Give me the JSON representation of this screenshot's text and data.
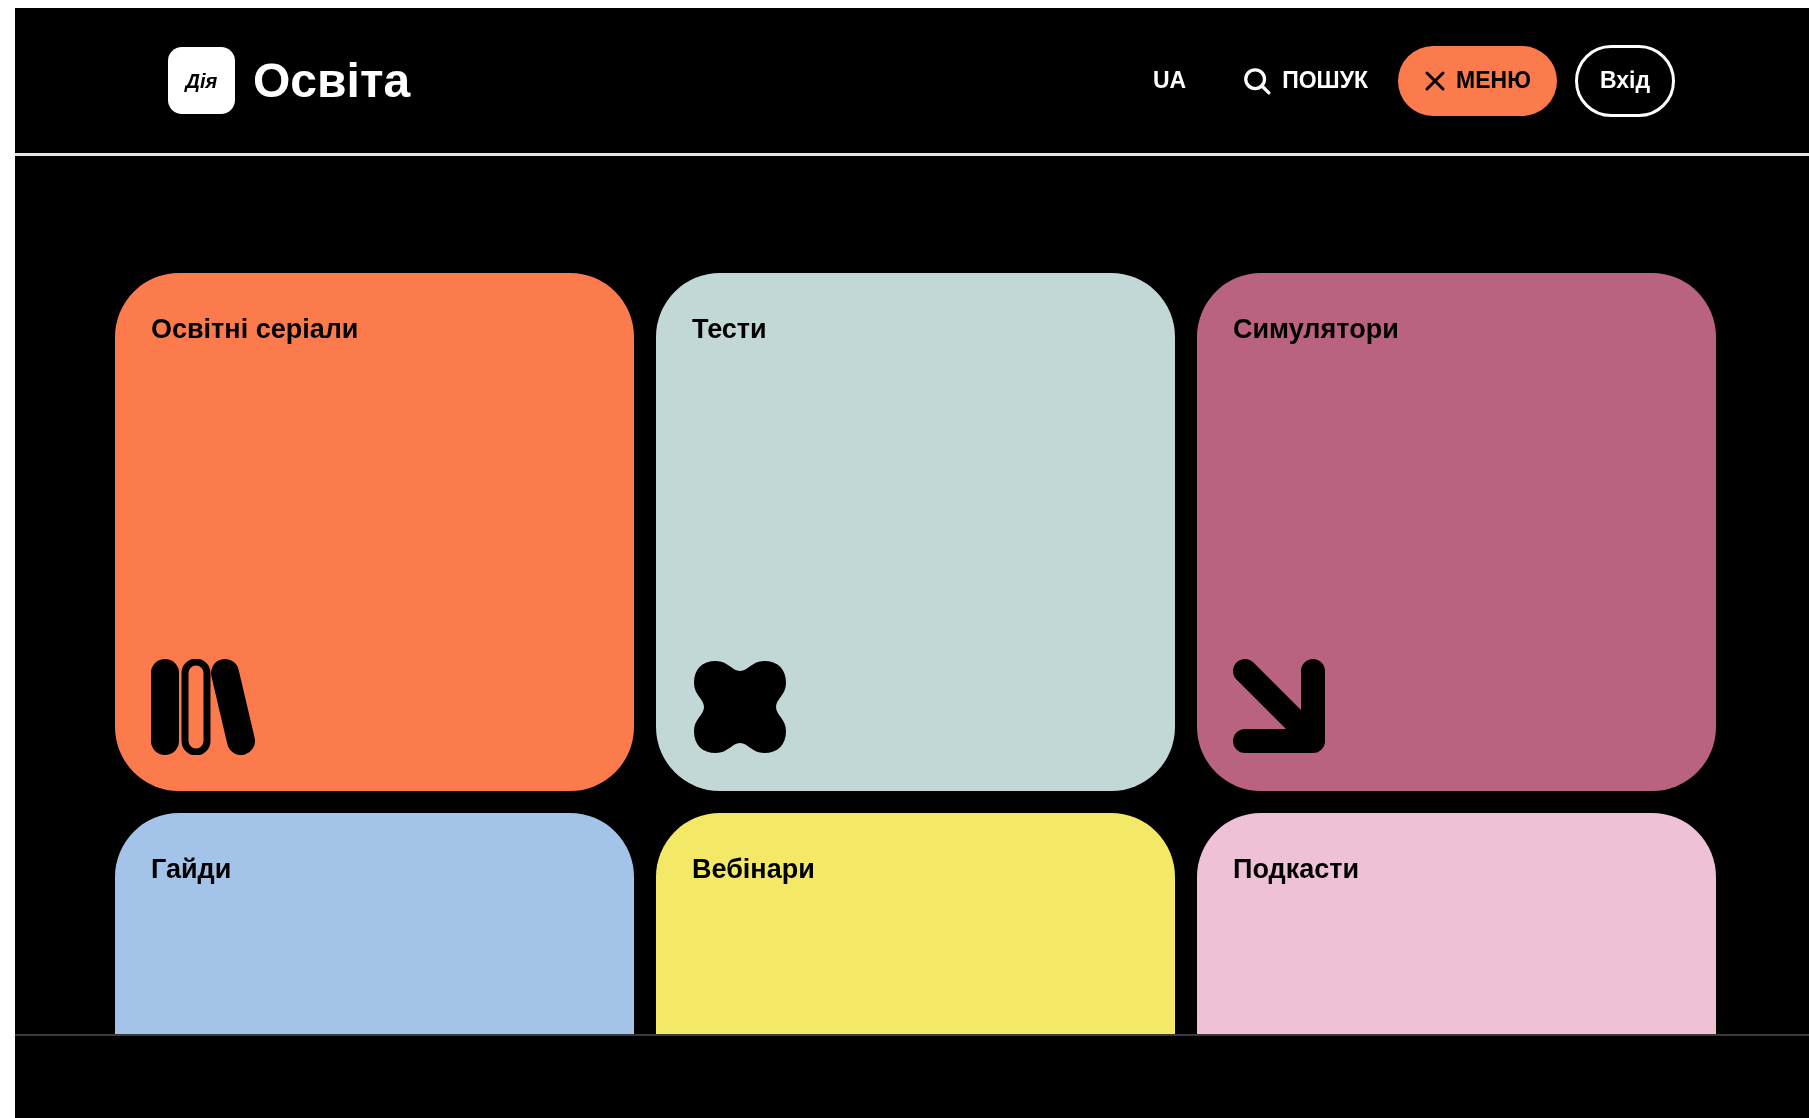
{
  "header": {
    "logo_badge": "Дія",
    "title": "Освіта",
    "language": "UA",
    "search": "ПОШУК",
    "menu_button": "МЕНЮ",
    "login_button": "Вхід"
  },
  "cards": [
    {
      "title": "Освітні серіали",
      "color": "#fc7b4d",
      "kind": "bars"
    },
    {
      "title": "Тести",
      "color": "#c2d8d7",
      "kind": "blob"
    },
    {
      "title": "Симулятори",
      "color": "#b96381",
      "kind": "arrow"
    },
    {
      "title": "Гайди",
      "color": "#a3c3e8",
      "kind": "none"
    },
    {
      "title": "Вебінари",
      "color": "#f3e967",
      "kind": "none"
    },
    {
      "title": "Подкасти",
      "color": "#efc1d6",
      "kind": "none"
    }
  ]
}
